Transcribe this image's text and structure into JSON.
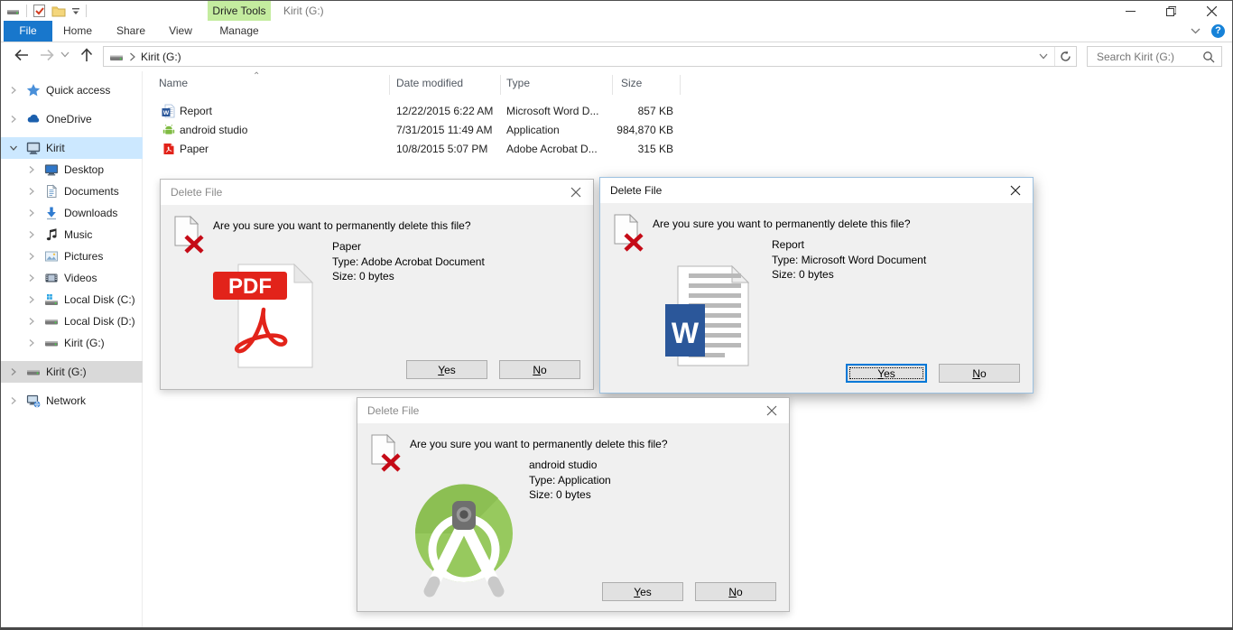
{
  "window": {
    "title": "Kirit (G:)",
    "contextual_tab_group": "Drive Tools"
  },
  "ribbon": {
    "file_tab": "File",
    "tabs": [
      "Home",
      "Share",
      "View"
    ],
    "contextual_tab": "Manage"
  },
  "nav": {
    "breadcrumb": "Kirit (G:)",
    "search_placeholder": "Search Kirit (G:)"
  },
  "sidebar": {
    "items": [
      {
        "label": "Quick access"
      },
      {
        "label": "OneDrive"
      },
      {
        "label": "Kirit"
      },
      {
        "label": "Desktop"
      },
      {
        "label": "Documents"
      },
      {
        "label": "Downloads"
      },
      {
        "label": "Music"
      },
      {
        "label": "Pictures"
      },
      {
        "label": "Videos"
      },
      {
        "label": "Local Disk (C:)"
      },
      {
        "label": "Local Disk (D:)"
      },
      {
        "label": "Kirit (G:)"
      },
      {
        "label": "Kirit (G:)"
      },
      {
        "label": "Network"
      }
    ]
  },
  "files": {
    "columns": {
      "name": "Name",
      "date": "Date modified",
      "type": "Type",
      "size": "Size"
    },
    "rows": [
      {
        "name": "Report",
        "date": "12/22/2015 6:22 AM",
        "type": "Microsoft Word D...",
        "size": "857 KB"
      },
      {
        "name": "android studio",
        "date": "7/31/2015 11:49 AM",
        "type": "Application",
        "size": "984,870 KB"
      },
      {
        "name": "Paper",
        "date": "10/8/2015 5:07 PM",
        "type": "Adobe Acrobat D...",
        "size": "315 KB"
      }
    ]
  },
  "dialogs": [
    {
      "title": "Delete File",
      "message": "Are you sure you want to permanently delete this file?",
      "file_name": "Paper",
      "type_line": "Type: Adobe Acrobat Document",
      "size_line": "Size: 0 bytes",
      "yes": "Yes",
      "no": "No",
      "pdf_banner": "PDF"
    },
    {
      "title": "Delete File",
      "message": "Are you sure you want to permanently delete this file?",
      "file_name": "Report",
      "type_line": "Type: Microsoft Word Document",
      "size_line": "Size: 0 bytes",
      "yes": "Yes",
      "no": "No",
      "word_letter": "W"
    },
    {
      "title": "Delete File",
      "message": "Are you sure you want to permanently delete this file?",
      "file_name": "android studio",
      "type_line": "Type: Application",
      "size_line": "Size: 0 bytes",
      "yes": "Yes",
      "no": "No"
    }
  ],
  "colors": {
    "accent": "#0078d7",
    "file_tab_blue": "#1877cc",
    "drive_tools_green": "#c4ec9f",
    "selection_blue": "#cce8ff",
    "selection_gray": "#d9d9d9",
    "delete_x_red": "#c50b17",
    "pdf_red": "#e2231a",
    "word_blue": "#2b579a",
    "android_green": "#97c95e"
  }
}
